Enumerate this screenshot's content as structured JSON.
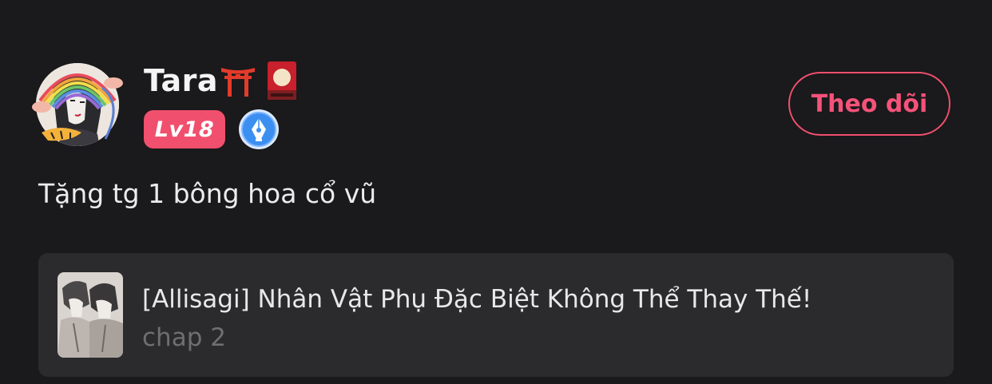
{
  "user": {
    "name": "Tara",
    "name_icons": [
      "torii-gate-icon",
      "hanafuda-card-icon"
    ],
    "level": "Lv18",
    "badge": "pen-nib-icon",
    "avatar": "avatar-image"
  },
  "follow_button": {
    "label": "Theo dõi"
  },
  "comment": {
    "text": "Tặng tg 1 bông hoa cổ vũ"
  },
  "story": {
    "title": "[Allisagi] Nhân Vật Phụ Đặc Biệt Không Thể Thay Thế!",
    "chapter": "chap 2",
    "thumbnail": "story-thumbnail-image"
  },
  "colors": {
    "background": "#1a191b",
    "accent": "#f0506e",
    "card": "#2b2a2c",
    "badge_blue": "#3b8ff0"
  }
}
